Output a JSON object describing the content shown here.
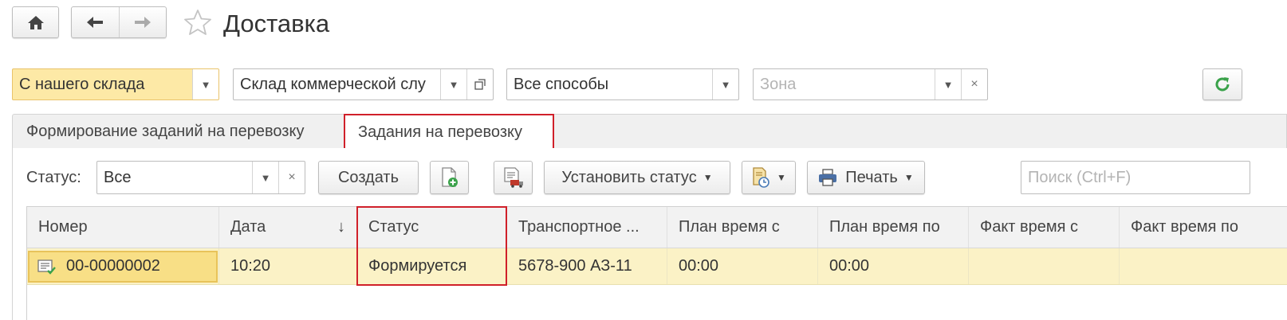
{
  "window": {
    "title": "Доставка"
  },
  "filters": {
    "source": "С нашего склада",
    "warehouse": "Склад коммерческой слу",
    "methods": "Все способы",
    "zone_placeholder": "Зона"
  },
  "tabs": [
    {
      "label": "Формирование заданий на перевозку"
    },
    {
      "label": "Задания на перевозку"
    }
  ],
  "toolbar": {
    "status_label": "Статус:",
    "status_value": "Все",
    "create_label": "Создать",
    "set_status_label": "Установить статус",
    "print_label": "Печать",
    "search_placeholder": "Поиск (Ctrl+F)"
  },
  "table": {
    "columns": [
      "Номер",
      "Дата",
      "Статус",
      "Транспортное ...",
      "План время с",
      "План время по",
      "Факт время с",
      "Факт время по"
    ],
    "sort_indicator": "↓",
    "rows": [
      [
        "00-00000002",
        "10:20",
        "Формируется",
        "5678-900 АЗ-11",
        "00:00",
        "00:00",
        "",
        ""
      ]
    ]
  },
  "colors": {
    "accent_yellow": "#fde9a6",
    "row_selected": "#fbf2c6",
    "highlight_red": "#d0202a",
    "refresh_green": "#3aa24a"
  },
  "icons": [
    "home-icon",
    "back-arrow-icon",
    "forward-arrow-icon",
    "star-icon",
    "refresh-icon",
    "dropdown-icon",
    "open-icon",
    "clear-icon",
    "add-document-icon",
    "delivery-document-icon",
    "schedule-icon",
    "printer-icon",
    "document-status-icon"
  ]
}
